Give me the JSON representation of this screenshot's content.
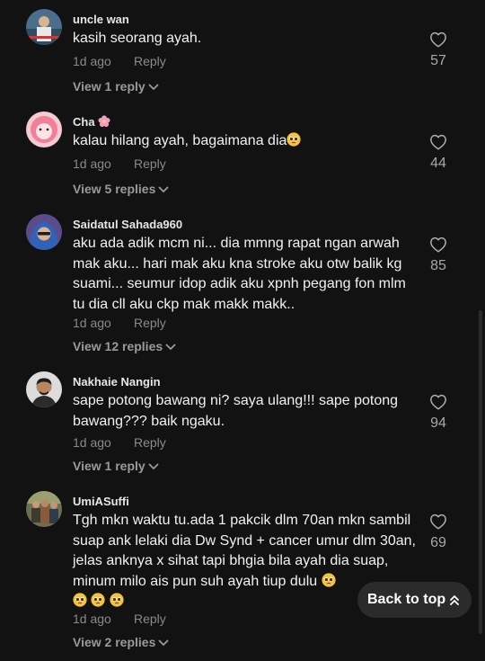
{
  "comments": [
    {
      "username": "uncle wan",
      "text": "kasih seorang ayah.",
      "time": "1d ago",
      "reply_label": "Reply",
      "view_replies": "View 1 reply",
      "likes": "57"
    },
    {
      "username": "Cha",
      "text": "kalau hilang ayah, bagaimana dia",
      "time": "1d ago",
      "reply_label": "Reply",
      "view_replies": "View 5 replies",
      "likes": "44"
    },
    {
      "username": "Saidatul Sahada960",
      "text": "aku ada adik mcm ni... dia mmng rapat ngan arwah mak aku... hari mak aku kna stroke aku otw balik kg suami... seumur idop adik aku xpnh pegang fon mlm tu dia cll aku ckp mak makk makk..",
      "time": "1d ago",
      "reply_label": "Reply",
      "view_replies": "View 12 replies",
      "likes": "85"
    },
    {
      "username": "Nakhaie Nangin",
      "text": "sape potong bawang ni? saya ulang!!! sape potong bawang??? baik ngaku.",
      "time": "1d ago",
      "reply_label": "Reply",
      "view_replies": "View 1 reply",
      "likes": "94"
    },
    {
      "username": "UmiASuffi",
      "text": "Tgh mkn waktu tu.ada 1 pakcik dlm 70an mkn sambil suap ank lelaki dia Dw Synd + cancer umur dlm 30an, jelas anknya x sihat tapi bhgia bila ayah dia suap, minum milo ais pun suh ayah tiup dulu",
      "time": "1d ago",
      "reply_label": "Reply",
      "view_replies": "View 2 replies",
      "likes": "69"
    }
  ],
  "back_to_top": "Back to top",
  "icons": {
    "like": "heart-outline-icon",
    "expand": "chevron-down-icon",
    "back_to_top": "double-chevron-up-icon",
    "emoji": "pleading-face-emoji",
    "flower": "cherry-blossom-emoji"
  },
  "colors": {
    "background": "#121212",
    "muted_text": "#8a8a8a",
    "button_bg": "#2b2b2b"
  }
}
